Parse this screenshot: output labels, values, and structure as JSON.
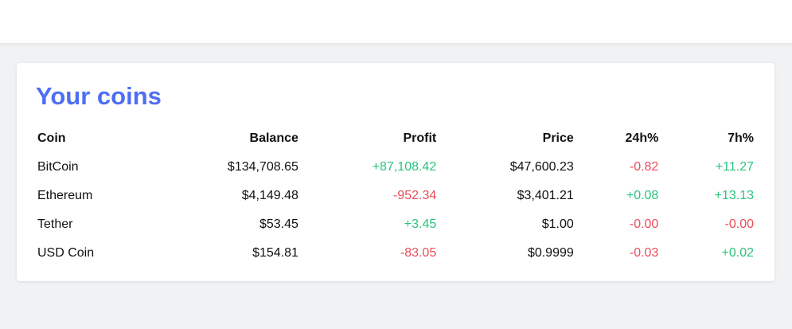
{
  "card": {
    "title": "Your coins"
  },
  "table": {
    "columns": [
      "Coin",
      "Balance",
      "Profit",
      "Price",
      "24h%",
      "7h%"
    ],
    "rows": [
      {
        "coin": "BitCoin",
        "balance": "$134,708.65",
        "profit": "+87,108.42",
        "profit_dir": "up",
        "price": "$47,600.23",
        "h24": "-0.82",
        "h24_dir": "down",
        "h7": "+11.27",
        "h7_dir": "up"
      },
      {
        "coin": "Ethereum",
        "balance": "$4,149.48",
        "profit": "-952.34",
        "profit_dir": "down",
        "price": "$3,401.21",
        "h24": "+0.08",
        "h24_dir": "up",
        "h7": "+13.13",
        "h7_dir": "up"
      },
      {
        "coin": "Tether",
        "balance": "$53.45",
        "profit": "+3.45",
        "profit_dir": "up",
        "price": "$1.00",
        "h24": "-0.00",
        "h24_dir": "down",
        "h7": "-0.00",
        "h7_dir": "down"
      },
      {
        "coin": "USD Coin",
        "balance": "$154.81",
        "profit": "-83.05",
        "profit_dir": "down",
        "price": "$0.9999",
        "h24": "-0.03",
        "h24_dir": "down",
        "h7": "+0.02",
        "h7_dir": "up"
      }
    ]
  },
  "colors": {
    "accent": "#4e6ef2",
    "positive": "#2bc47d",
    "negative": "#e94d5a",
    "background": "#f1f2f4"
  }
}
